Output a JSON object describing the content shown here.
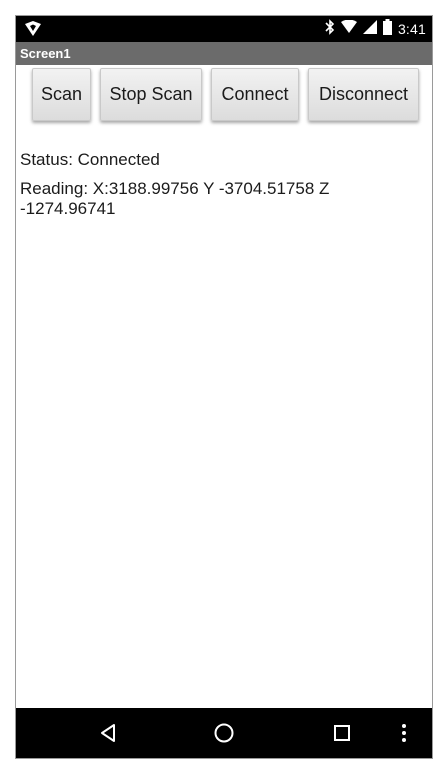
{
  "status_bar": {
    "time": "3:41",
    "icons": [
      "app-shield-icon",
      "bluetooth-icon",
      "wifi-icon",
      "cell-signal-icon",
      "battery-icon"
    ]
  },
  "app": {
    "title": "Screen1"
  },
  "buttons": {
    "scan": "Scan",
    "stop_scan": "Stop Scan",
    "connect": "Connect",
    "disconnect": "Disconnect"
  },
  "labels": {
    "status": "Status: Connected",
    "reading": "Reading: X:3188.99756 Y -3704.51758 Z -1274.96741"
  },
  "nav_bar": {
    "icons": [
      "back-icon",
      "home-icon",
      "recents-icon",
      "more-icon"
    ]
  }
}
